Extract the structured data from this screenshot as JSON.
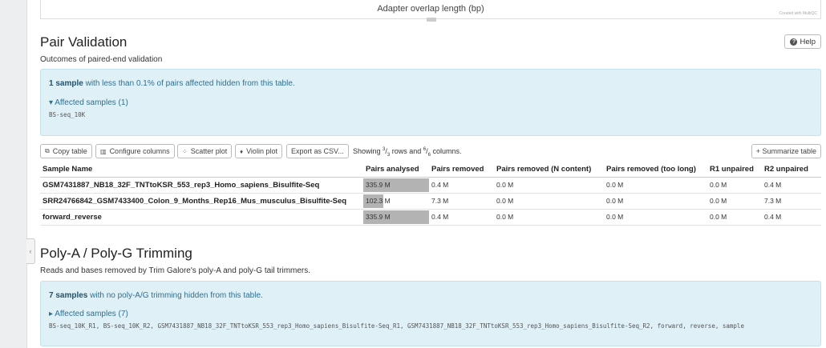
{
  "plot": {
    "xlabel": "Adapter overlap length (bp)",
    "credit": "Created with MultiQC"
  },
  "pair_validation": {
    "title": "Pair Validation",
    "subtitle": "Outcomes of paired-end validation",
    "help_label": "Help",
    "info": {
      "count_bold": "1 sample",
      "rest": " with less than 0.1% of pairs affected hidden from this table."
    },
    "affected_label": "▾ Affected samples (1)",
    "affected_list": "BS-seq_10K",
    "toolbar": {
      "copy": "Copy table",
      "configure": "Configure columns",
      "scatter": "Scatter plot",
      "violin": "Violin plot",
      "export": "Export as CSV...",
      "summarize": "+ Summarize table",
      "status_prefix": "Showing ",
      "rows_shown": "3",
      "rows_total": "3",
      "status_mid": " rows and ",
      "cols_shown": "6",
      "cols_total": "6",
      "status_suffix": " columns."
    },
    "columns": [
      "Sample Name",
      "Pairs analysed",
      "Pairs removed",
      "Pairs removed (N content)",
      "Pairs removed (too long)",
      "R1 unpaired",
      "R2 unpaired"
    ],
    "rows": [
      {
        "name": "GSM7431887_NB18_32F_TNTtoKSR_553_rep3_Homo_sapiens_Bisulfite-Seq",
        "analysed": "335.9 M",
        "analysed_frac": 1.0,
        "removed": "0.4 M",
        "n_content": "0.0 M",
        "too_long": "0.0 M",
        "r1": "0.0 M",
        "r2": "0.4 M"
      },
      {
        "name": "SRR24766842_GSM7433400_Colon_9_Months_Rep16_Mus_musculus_Bisulfite-Seq",
        "analysed": "102.3 M",
        "analysed_frac": 0.305,
        "removed": "7.3 M",
        "n_content": "0.0 M",
        "too_long": "0.0 M",
        "r1": "0.0 M",
        "r2": "7.3 M"
      },
      {
        "name": "forward_reverse",
        "analysed": "335.9 M",
        "analysed_frac": 1.0,
        "removed": "0.4 M",
        "n_content": "0.0 M",
        "too_long": "0.0 M",
        "r1": "0.0 M",
        "r2": "0.4 M"
      }
    ]
  },
  "polya": {
    "title": "Poly-A / Poly-G Trimming",
    "subtitle": "Reads and bases removed by Trim Galore's poly-A and poly-G tail trimmers.",
    "info": {
      "count_bold": "7 samples",
      "rest": " with no poly-A/G trimming hidden from this table."
    },
    "affected_label": "▸ Affected samples (7)",
    "affected_list": "BS-seq_10K_R1, BS-seq_10K_R2, GSM7431887_NB18_32F_TNTtoKSR_553_rep3_Homo_sapiens_Bisulfite-Seq_R1, GSM7431887_NB18_32F_TNTtoKSR_553_rep3_Homo_sapiens_Bisulfite-Seq_R2, forward, reverse, sample"
  },
  "colors": {
    "info_bg": "#dff0f6",
    "info_text": "#31708f",
    "bar": "#b3b3b3"
  }
}
